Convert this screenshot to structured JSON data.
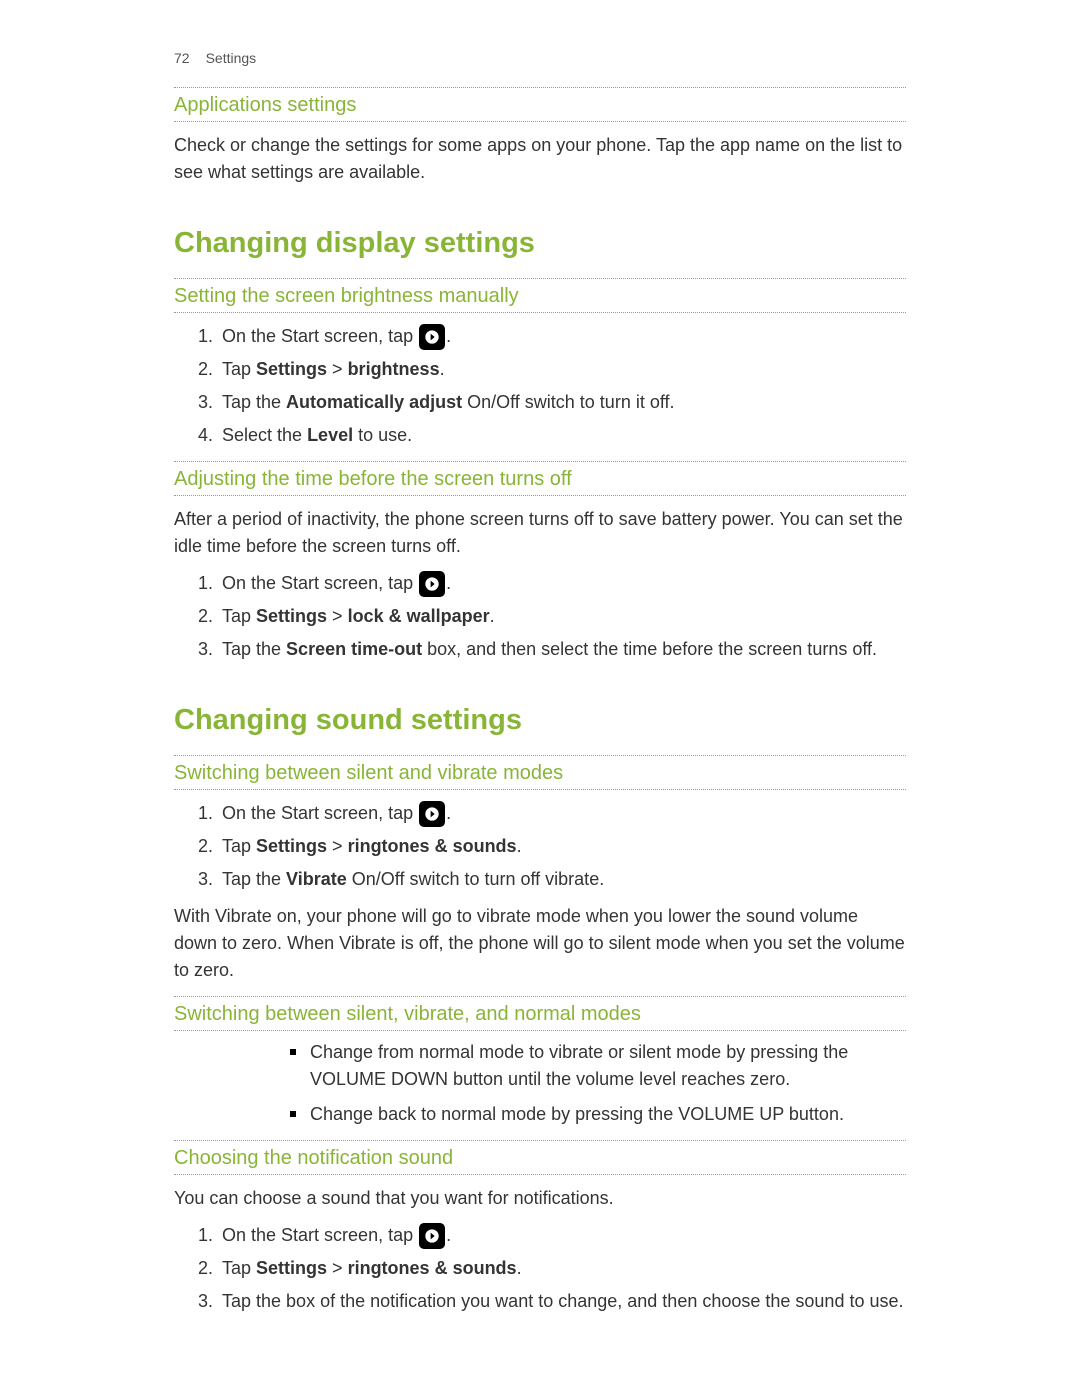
{
  "header": {
    "page_number": "72",
    "chapter": "Settings"
  },
  "sec_apps": {
    "title": "Applications settings",
    "body": "Check or change the settings for some apps on your phone. Tap the app name on the list to see what settings are available."
  },
  "major_display": "Changing display settings",
  "sec_brightness": {
    "title": "Setting the screen brightness manually",
    "step1_pre": "On the Start screen, tap ",
    "step1_post": ".",
    "step2_pre": "Tap ",
    "step2_bold1": "Settings",
    "step2_mid": " > ",
    "step2_bold2": "brightness",
    "step2_post": ".",
    "step3_pre": "Tap the ",
    "step3_bold": "Automatically adjust",
    "step3_post": " On/Off switch to turn it off.",
    "step4_pre": "Select the ",
    "step4_bold": "Level",
    "step4_post": " to use."
  },
  "sec_timeout": {
    "title": "Adjusting the time before the screen turns off",
    "intro": "After a period of inactivity, the phone screen turns off to save battery power. You can set the idle time before the screen turns off.",
    "step1_pre": "On the Start screen, tap ",
    "step1_post": ".",
    "step2_pre": "Tap ",
    "step2_bold1": "Settings",
    "step2_mid": " > ",
    "step2_bold2": "lock & wallpaper",
    "step2_post": ".",
    "step3_pre": "Tap the ",
    "step3_bold": "Screen time-out",
    "step3_post": " box, and then select the time before the screen turns off."
  },
  "major_sound": "Changing sound settings",
  "sec_silent_vibrate": {
    "title": "Switching between silent and vibrate modes",
    "step1_pre": "On the Start screen, tap ",
    "step1_post": ".",
    "step2_pre": "Tap ",
    "step2_bold1": "Settings",
    "step2_mid": " > ",
    "step2_bold2": "ringtones & sounds",
    "step2_post": ".",
    "step3_pre": "Tap the ",
    "step3_bold": "Vibrate",
    "step3_post": " On/Off switch to turn off vibrate.",
    "outro": "With Vibrate on, your phone will go to vibrate mode when you lower the sound volume down to zero. When Vibrate is off, the phone will go to silent mode when you set the volume to zero."
  },
  "sec_modes": {
    "title": "Switching between silent, vibrate, and normal modes",
    "bullet1": "Change from normal mode to vibrate or silent mode by pressing the VOLUME DOWN button until the volume level reaches zero.",
    "bullet2": "Change back to normal mode by pressing the VOLUME UP button."
  },
  "sec_notif": {
    "title": "Choosing the notification sound",
    "intro": "You can choose a sound that you want for notifications.",
    "step1_pre": "On the Start screen, tap ",
    "step1_post": ".",
    "step2_pre": "Tap ",
    "step2_bold1": "Settings",
    "step2_mid": " > ",
    "step2_bold2": "ringtones & sounds",
    "step2_post": ".",
    "step3": "Tap the box of the notification you want to change, and then choose the sound to use."
  }
}
